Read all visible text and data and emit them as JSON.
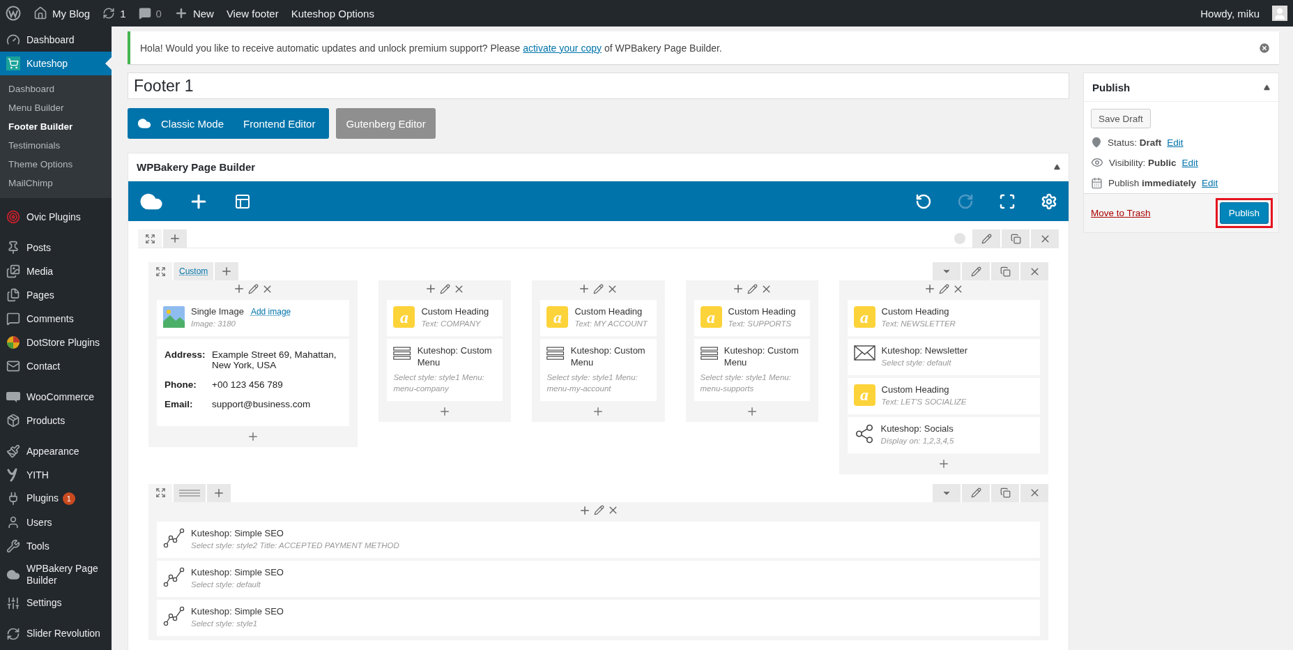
{
  "admin_bar": {
    "site": "My Blog",
    "updates": "1",
    "comments": "0",
    "new": "New",
    "links": [
      "View footer",
      "Kuteshop Options"
    ],
    "greeting": "Howdy, miku"
  },
  "sidebar": {
    "groups": [
      [
        {
          "label": "Dashboard",
          "selected": false
        },
        {
          "label": "Kuteshop",
          "selected": true,
          "children": [
            {
              "label": "Dashboard",
              "selected": false
            },
            {
              "label": "Menu Builder",
              "selected": false
            },
            {
              "label": "Footer Builder",
              "selected": true
            },
            {
              "label": "Testimonials",
              "selected": false
            },
            {
              "label": "Theme Options",
              "selected": false
            },
            {
              "label": "MailChimp",
              "selected": false
            }
          ]
        }
      ],
      [
        {
          "label": "Ovic Plugins",
          "selected": false
        }
      ],
      [
        {
          "label": "Posts",
          "selected": false
        },
        {
          "label": "Media",
          "selected": false
        },
        {
          "label": "Pages",
          "selected": false
        },
        {
          "label": "Comments",
          "selected": false
        },
        {
          "label": "DotStore Plugins",
          "selected": false
        },
        {
          "label": "Contact",
          "selected": false
        }
      ],
      [
        {
          "label": "WooCommerce",
          "selected": false
        },
        {
          "label": "Products",
          "selected": false
        }
      ],
      [
        {
          "label": "Appearance",
          "selected": false
        },
        {
          "label": "YITH",
          "selected": false
        },
        {
          "label": "Plugins",
          "selected": false,
          "badge": "1"
        },
        {
          "label": "Users",
          "selected": false
        },
        {
          "label": "Tools",
          "selected": false
        },
        {
          "label": "WPBakery Page Builder",
          "selected": false
        },
        {
          "label": "Settings",
          "selected": false
        }
      ],
      [
        {
          "label": "Slider Revolution",
          "selected": false
        }
      ]
    ]
  },
  "notice": {
    "text_before": "Hola! Would you like to receive automatic updates and unlock premium support? Please ",
    "link": "activate your copy",
    "text_after": " of WPBakery Page Builder."
  },
  "title_field": {
    "value": "Footer 1"
  },
  "mode_buttons": [
    {
      "label": "Classic Mode",
      "kind": "primary"
    },
    {
      "label": "Frontend Editor",
      "kind": "primary"
    },
    {
      "label": "Gutenberg Editor",
      "kind": "secondary"
    }
  ],
  "builder": {
    "title": "WPBakery Page Builder",
    "redo_disabled": true,
    "rows": [
      {
        "kind": "columns",
        "tab_label": "Custom",
        "columns": [
          {
            "elements": [
              {
                "kind": "image",
                "title": "Single Image",
                "link": "Add image",
                "detail": "Image: 3180"
              },
              {
                "kind": "contact",
                "fields": [
                  {
                    "label": "Address:",
                    "value": "Example Street 69, Mahattan, New York, USA"
                  },
                  {
                    "label": "Phone:",
                    "value": "+00 123 456 789"
                  },
                  {
                    "label": "Email:",
                    "value": "support@business.com"
                  }
                ]
              }
            ]
          },
          {
            "elements": [
              {
                "kind": "heading",
                "badge": "a",
                "title": "Custom Heading",
                "detail": "Text: COMPANY"
              },
              {
                "kind": "menu",
                "title": "Kuteshop: Custom Menu",
                "detail": "Select style: style1  Menu: menu-company"
              }
            ]
          },
          {
            "elements": [
              {
                "kind": "heading",
                "badge": "a",
                "title": "Custom Heading",
                "detail": "Text: MY ACCOUNT"
              },
              {
                "kind": "menu",
                "title": "Kuteshop: Custom Menu",
                "detail": "Select style: style1  Menu: menu-my-account"
              }
            ]
          },
          {
            "elements": [
              {
                "kind": "heading",
                "badge": "a",
                "title": "Custom Heading",
                "detail": "Text: SUPPORTS"
              },
              {
                "kind": "menu",
                "title": "Kuteshop: Custom Menu",
                "detail": "Select style: style1  Menu: menu-supports"
              }
            ]
          },
          {
            "elements": [
              {
                "kind": "heading",
                "badge": "a",
                "title": "Custom Heading",
                "detail": "Text: NEWSLETTER"
              },
              {
                "kind": "newsletter",
                "title": "Kuteshop: Newsletter",
                "detail": "Select style: default"
              },
              {
                "kind": "heading",
                "badge": "a",
                "title": "Custom Heading",
                "detail": "Text: LET'S SOCIALIZE"
              },
              {
                "kind": "socials",
                "title": "Kuteshop: Socials",
                "detail": "Display on: 1,2,3,4,5"
              }
            ]
          }
        ]
      },
      {
        "kind": "full",
        "columns": [
          {
            "elements": [
              {
                "kind": "seo",
                "title": "Kuteshop: Simple SEO",
                "detail": "Select style: style2  Title: ACCEPTED PAYMENT METHOD"
              },
              {
                "kind": "seo",
                "title": "Kuteshop: Simple SEO",
                "detail": "Select style: default"
              },
              {
                "kind": "seo",
                "title": "Kuteshop: Simple SEO",
                "detail": "Select style: style1"
              }
            ]
          }
        ]
      }
    ]
  },
  "publish": {
    "title": "Publish",
    "save_draft": "Save Draft",
    "status": "Status: **Draft**",
    "visibility": "Visibility: **Public**",
    "schedule": "Publish **immediately**",
    "edit_links": [
      "Edit",
      "Edit",
      "Edit"
    ],
    "trash": "Move to Trash",
    "button": "Publish",
    "highlighted": true
  }
}
